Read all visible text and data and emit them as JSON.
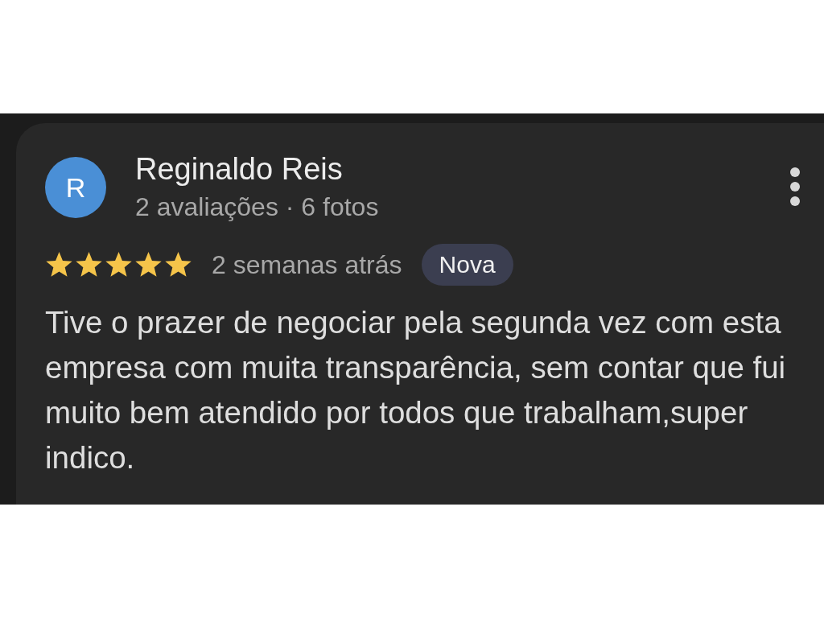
{
  "review": {
    "avatar_letter": "R",
    "author": "Reginaldo Reis",
    "author_meta": "2 avaliações · 6 fotos",
    "stars": 5,
    "time": "2 semanas atrás",
    "badge": "Nova",
    "text": "Tive o prazer de negociar pela segunda vez com esta empresa com muita transparência, sem contar que fui muito bem atendido por todos que trabalham,super indico."
  }
}
